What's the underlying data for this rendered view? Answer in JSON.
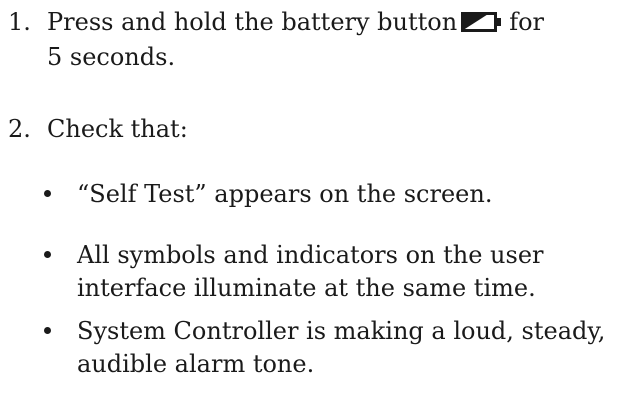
{
  "steps": [
    {
      "number": "1.",
      "text_before_icon": "Press and hold the battery button",
      "icon": "battery-icon",
      "text_after_icon": "for",
      "line2": "5 seconds."
    },
    {
      "number": "2.",
      "text": "Check that:",
      "bullets": [
        {
          "lines": [
            "“Self Test” appears on the screen."
          ]
        },
        {
          "lines": [
            "All symbols and indicators on the user",
            "interface illuminate at the same time."
          ]
        },
        {
          "lines": [
            "System Controller is making a loud, steady,",
            "audible alarm tone."
          ]
        }
      ]
    }
  ]
}
